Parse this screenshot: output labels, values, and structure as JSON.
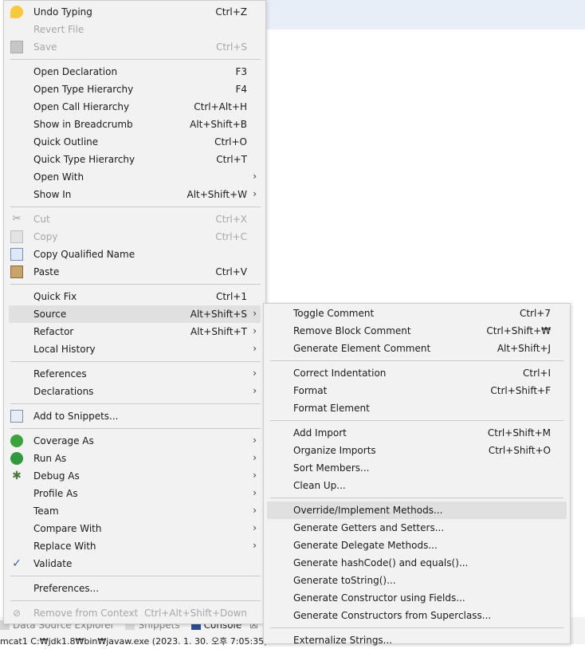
{
  "main_menu": {
    "undo_typing": {
      "label": "Undo Typing",
      "shortcut": "Ctrl+Z",
      "icon": "undo-icon"
    },
    "revert_file": {
      "label": "Revert File"
    },
    "save": {
      "label": "Save",
      "shortcut": "Ctrl+S",
      "icon": "save-icon"
    },
    "open_declaration": {
      "label": "Open Declaration",
      "shortcut": "F3"
    },
    "open_type_hierarchy": {
      "label": "Open Type Hierarchy",
      "shortcut": "F4"
    },
    "open_call_hierarchy": {
      "label": "Open Call Hierarchy",
      "shortcut": "Ctrl+Alt+H"
    },
    "show_in_breadcrumb": {
      "label": "Show in Breadcrumb",
      "shortcut": "Alt+Shift+B"
    },
    "quick_outline": {
      "label": "Quick Outline",
      "shortcut": "Ctrl+O"
    },
    "quick_type_hierarchy": {
      "label": "Quick Type Hierarchy",
      "shortcut": "Ctrl+T"
    },
    "open_with": {
      "label": "Open With"
    },
    "show_in": {
      "label": "Show In",
      "shortcut": "Alt+Shift+W"
    },
    "cut": {
      "label": "Cut",
      "shortcut": "Ctrl+X",
      "icon": "scissors-icon"
    },
    "copy": {
      "label": "Copy",
      "shortcut": "Ctrl+C",
      "icon": "copy-icon"
    },
    "copy_qualified_name": {
      "label": "Copy Qualified Name",
      "icon": "copy-qualified-name-icon"
    },
    "paste": {
      "label": "Paste",
      "shortcut": "Ctrl+V",
      "icon": "clipboard-icon"
    },
    "quick_fix": {
      "label": "Quick Fix",
      "shortcut": "Ctrl+1"
    },
    "source": {
      "label": "Source",
      "shortcut": "Alt+Shift+S"
    },
    "refactor": {
      "label": "Refactor",
      "shortcut": "Alt+Shift+T"
    },
    "local_history": {
      "label": "Local History"
    },
    "references": {
      "label": "References"
    },
    "declarations": {
      "label": "Declarations"
    },
    "add_to_snippets": {
      "label": "Add to Snippets...",
      "icon": "snippet-icon"
    },
    "coverage_as": {
      "label": "Coverage As",
      "icon": "coverage-icon"
    },
    "run_as": {
      "label": "Run As",
      "icon": "run-icon"
    },
    "debug_as": {
      "label": "Debug As",
      "icon": "bug-icon"
    },
    "profile_as": {
      "label": "Profile As"
    },
    "team": {
      "label": "Team"
    },
    "compare_with": {
      "label": "Compare With"
    },
    "replace_with": {
      "label": "Replace With"
    },
    "validate": {
      "label": "Validate",
      "icon": "checkmark-icon"
    },
    "preferences": {
      "label": "Preferences..."
    },
    "remove_from_context": {
      "label": "Remove from Context",
      "shortcut": "Ctrl+Alt+Shift+Down",
      "icon": "remove-context-icon"
    }
  },
  "source_submenu": {
    "toggle_comment": {
      "label": "Toggle Comment",
      "shortcut": "Ctrl+7"
    },
    "remove_block_comment": {
      "label": "Remove Block Comment",
      "shortcut": "Ctrl+Shift+₩"
    },
    "generate_element_comment": {
      "label": "Generate Element Comment",
      "shortcut": "Alt+Shift+J"
    },
    "correct_indentation": {
      "label": "Correct Indentation",
      "shortcut": "Ctrl+I"
    },
    "format": {
      "label": "Format",
      "shortcut": "Ctrl+Shift+F"
    },
    "format_element": {
      "label": "Format Element"
    },
    "add_import": {
      "label": "Add Import",
      "shortcut": "Ctrl+Shift+M"
    },
    "organize_imports": {
      "label": "Organize Imports",
      "shortcut": "Ctrl+Shift+O"
    },
    "sort_members": {
      "label": "Sort Members..."
    },
    "clean_up": {
      "label": "Clean Up..."
    },
    "override_implement": {
      "label": "Override/Implement Methods..."
    },
    "generate_getters_setters": {
      "label": "Generate Getters and Setters..."
    },
    "generate_delegate": {
      "label": "Generate Delegate Methods..."
    },
    "generate_hashcode_equals": {
      "label": "Generate hashCode() and equals()..."
    },
    "generate_tostring": {
      "label": "Generate toString()..."
    },
    "generate_ctor_fields": {
      "label": "Generate Constructor using Fields..."
    },
    "generate_ctor_super": {
      "label": "Generate Constructors from Superclass..."
    },
    "externalize_strings": {
      "label": "Externalize Strings..."
    }
  },
  "submenu_arrow": "›",
  "bottom_panel": {
    "tabs": [
      {
        "label": "Data Source Explorer",
        "icon": "data-source-icon"
      },
      {
        "label": "Snippets",
        "icon": "snippets-icon"
      },
      {
        "label": "Console",
        "icon": "console-icon"
      }
    ],
    "close_glyph": "☒",
    "console_line": "mcat1 C:₩jdk1.8₩bin₩javaw.exe (2023. 1. 30. 오후 7:05:35)"
  }
}
